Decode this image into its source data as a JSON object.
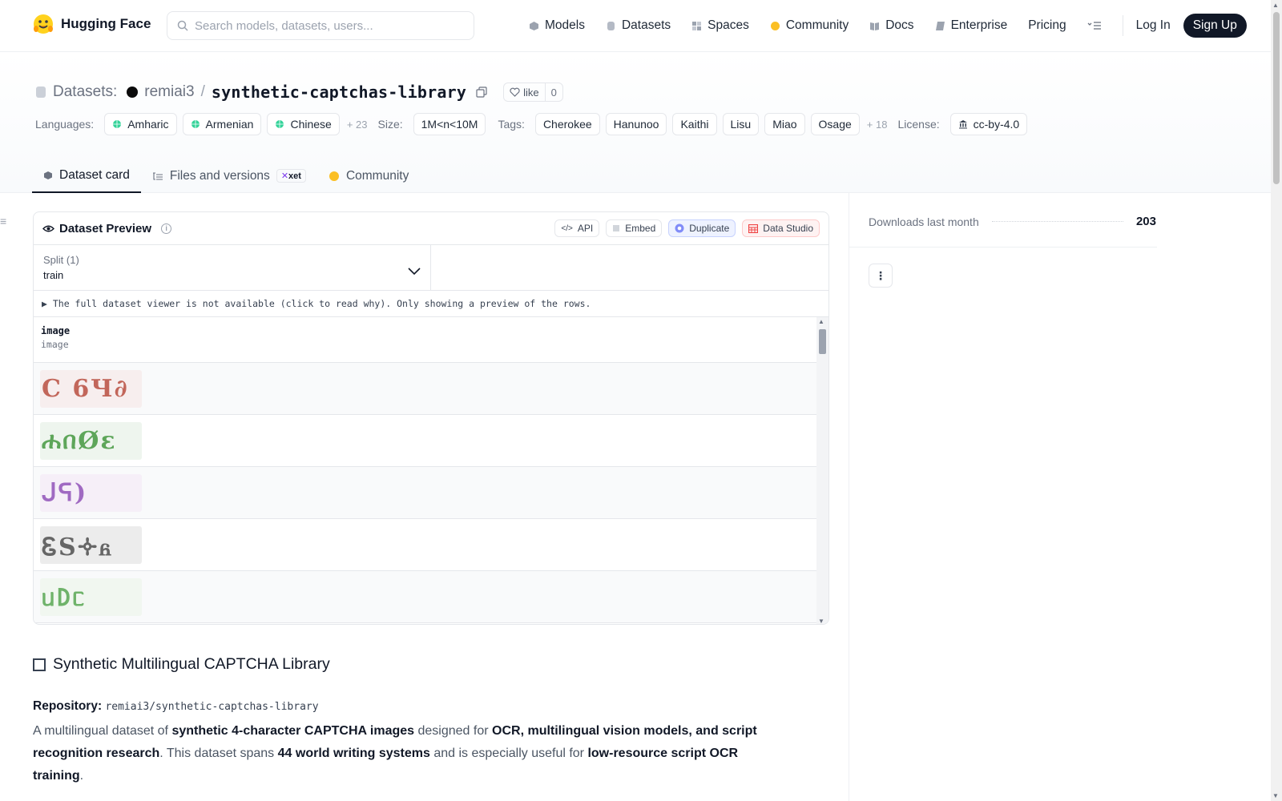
{
  "nav": {
    "brand": "Hugging Face",
    "search_placeholder": "Search models, datasets, users...",
    "links": [
      "Models",
      "Datasets",
      "Spaces",
      "Community",
      "Docs",
      "Enterprise",
      "Pricing"
    ],
    "login": "Log In",
    "signup": "Sign Up"
  },
  "header": {
    "datasets_label": "Datasets:",
    "owner": "remiai3",
    "slash": "/",
    "repo": "synthetic-captchas-library",
    "like_label": "like",
    "like_count": "0",
    "languages_label": "Languages:",
    "languages": [
      "Amharic",
      "Armenian",
      "Chinese"
    ],
    "languages_more": "+ 23",
    "size_label": "Size:",
    "size": "1M<n<10M",
    "tags_label": "Tags:",
    "tags": [
      "Cherokee",
      "Hanunoo",
      "Kaithi",
      "Lisu",
      "Miao",
      "Osage"
    ],
    "tags_more": "+ 18",
    "license_label": "License:",
    "license": "cc-by-4.0"
  },
  "tabs": {
    "dataset_card": "Dataset card",
    "files": "Files and versions",
    "files_badge": "xet",
    "community": "Community"
  },
  "preview": {
    "title": "Dataset Preview",
    "actions": [
      "API",
      "Embed",
      "Duplicate",
      "Data Studio"
    ],
    "split_label": "Split (1)",
    "split_value": "train",
    "notice": "▶ The full dataset viewer is not available (click to read why). Only showing a preview of the rows.",
    "column_name": "image",
    "column_type": "image",
    "rows": [
      {
        "text": "C 6Ч∂",
        "color": "#c2665a",
        "bg": "#f7eeee"
      },
      {
        "text": "ሐበØε",
        "color": "#5ea65a",
        "bg": "#eef5ee"
      },
      {
        "text": "ᒍᕋ)",
        "color": "#a06ac2",
        "bg": "#f6eff8"
      },
      {
        "text": "ᏋS🝊ᏺ",
        "color": "#666666",
        "bg": "#ececec"
      },
      {
        "text": "ᥙ𑀥ᥴ",
        "color": "#6fb36a",
        "bg": "#f1f7f0"
      }
    ]
  },
  "card": {
    "title": "Synthetic Multilingual CAPTCHA Library",
    "repo_label": "Repository:",
    "repo_value": "remiai3/synthetic-captchas-library",
    "desc_1": "A multilingual dataset of ",
    "desc_b1": "synthetic 4-character CAPTCHA images",
    "desc_2": " designed for ",
    "desc_b2": "OCR, multilingual vision models, and script recognition research",
    "desc_3": ". This dataset spans ",
    "desc_b3": "44 world writing systems",
    "desc_4": " and is especially useful for ",
    "desc_b4": "low-resource script OCR training",
    "desc_5": "."
  },
  "sidebar": {
    "downloads_label": "Downloads last month",
    "downloads_value": "203"
  }
}
